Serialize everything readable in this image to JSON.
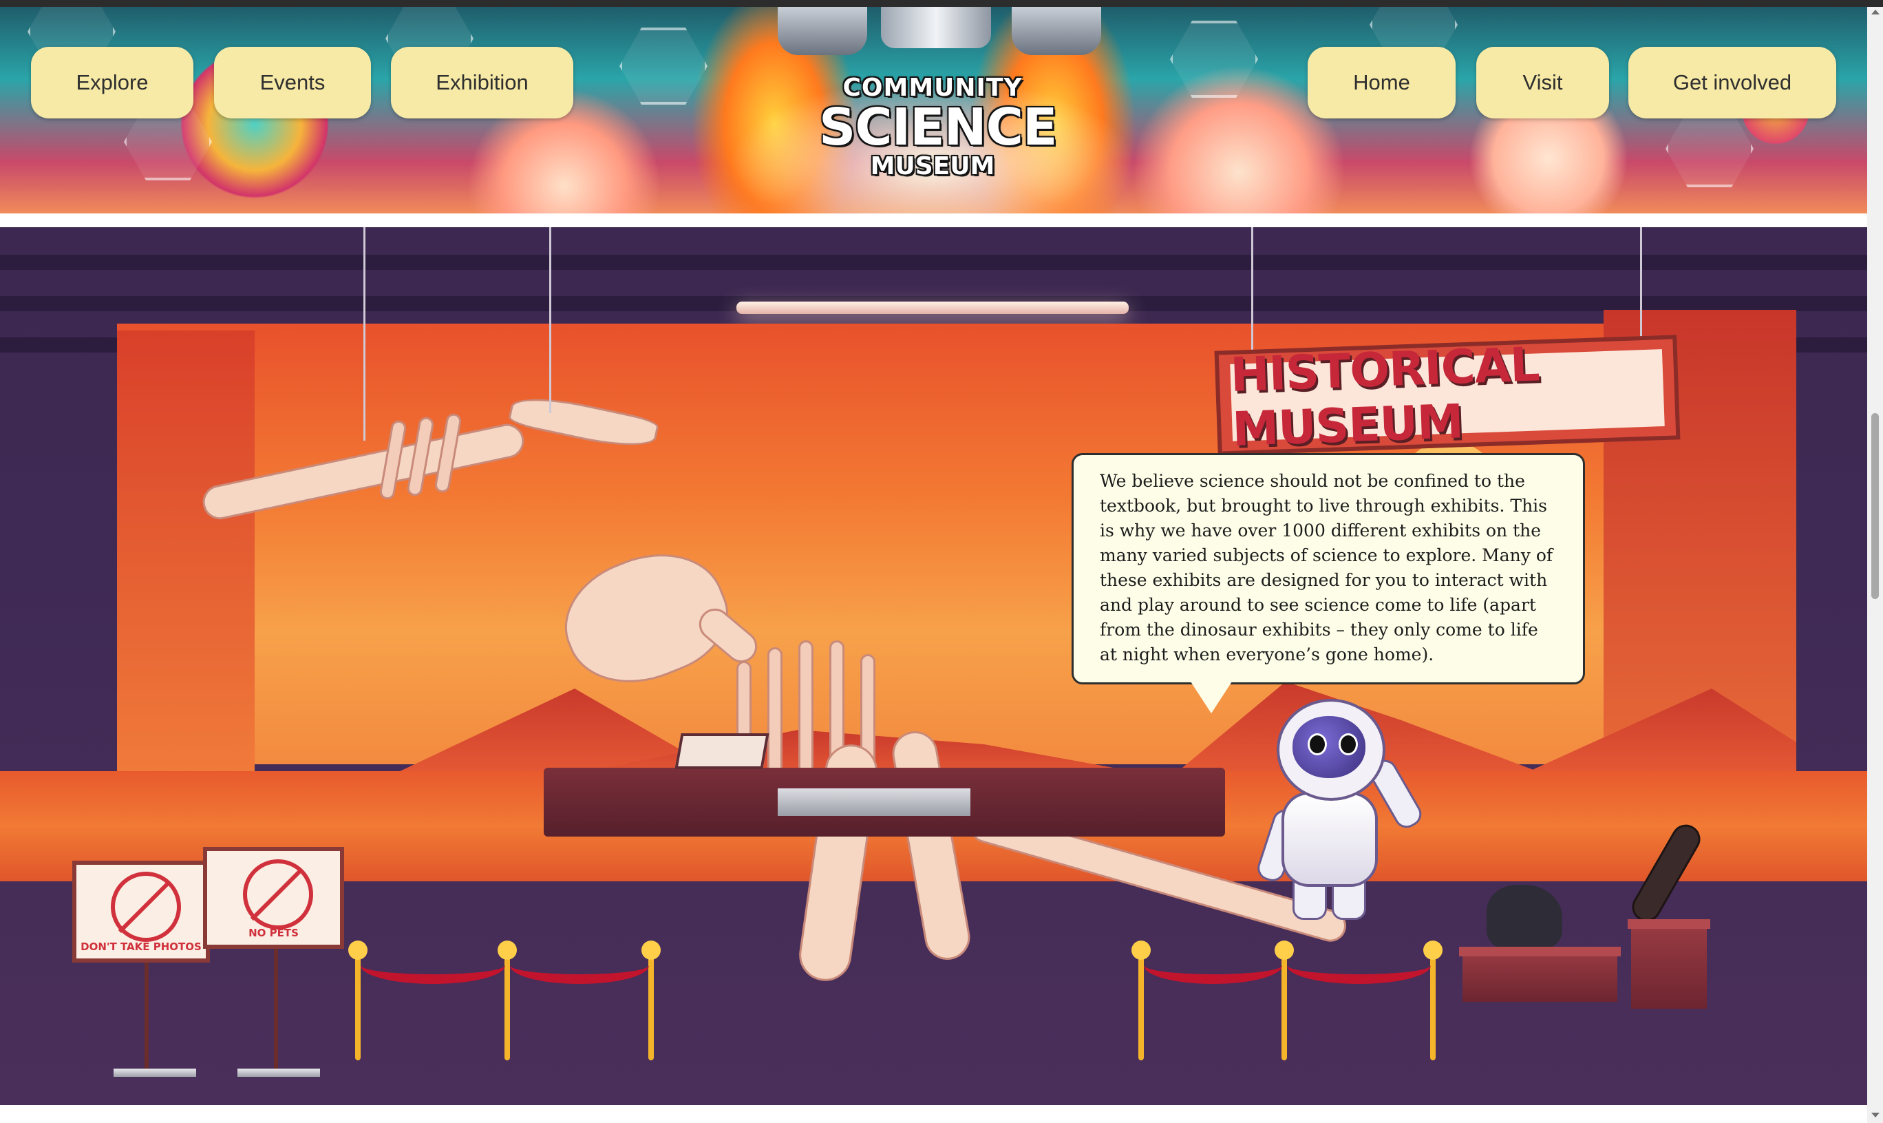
{
  "header": {
    "logo": {
      "line1": "COMMUNITY",
      "line2": "SCIENCE",
      "line3": "MUSEUM"
    },
    "nav_left": [
      {
        "label": "Explore"
      },
      {
        "label": "Events"
      },
      {
        "label": "Exhibition"
      }
    ],
    "nav_right": [
      {
        "label": "Home"
      },
      {
        "label": "Visit"
      },
      {
        "label": "Get involved"
      }
    ],
    "button_color": "#f7eaa6"
  },
  "hero": {
    "sign_text": "HISTORICAL MUSEUM",
    "speech_bubble": "We believe science should not be confined to the textbook, but brought to live through exhibits. This is why we have over 1000 different exhibits on the many varied subjects of science to explore. Many of these exhibits are designed for you to interact with and play around to see science come to life (apart from the dinosaur exhibits – they only come to life at night when everyone’s gone home).",
    "warning_signs": [
      {
        "label": "DON'T TAKE PHOTOS",
        "icon": "camera-icon"
      },
      {
        "label": "NO PETS",
        "icon": "pet-icon"
      }
    ]
  },
  "colors": {
    "scene_wall": "#f37a33",
    "ceiling": "#3c2850",
    "sign_red": "#c6283a",
    "bubble_bg": "#fdfde8"
  }
}
